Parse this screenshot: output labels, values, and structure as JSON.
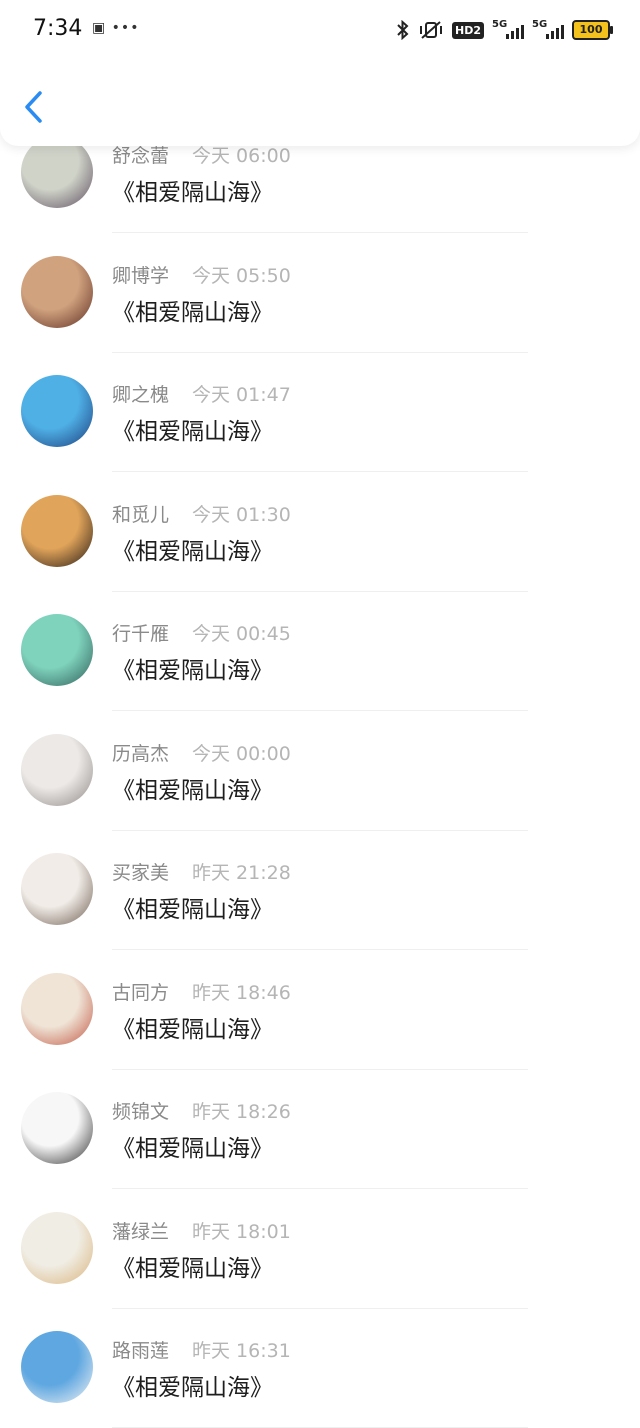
{
  "status_bar": {
    "time": "7:34",
    "misc": "▣ •••",
    "bluetooth_icon": "bluetooth-icon",
    "mute_icon": "vibrate-off-icon",
    "hd_badge": "HD2",
    "sim1": "5G",
    "sim2": "5G",
    "battery": "100",
    "battery_color": "#f3c21d"
  },
  "nav": {
    "back_icon": "chevron-left-icon",
    "accent": "#2a8cf2"
  },
  "items": [
    {
      "name": "舒念蕾",
      "time": "今天 06:00",
      "message": "《相爱隔山海》",
      "avatar_colors": [
        "#cfd3c8",
        "#5b4a5e"
      ]
    },
    {
      "name": "卿博学",
      "time": "今天 05:50",
      "message": "《相爱隔山海》",
      "avatar_colors": [
        "#d1a27e",
        "#5a2a20"
      ]
    },
    {
      "name": "卿之槐",
      "time": "今天 01:47",
      "message": "《相爱隔山海》",
      "avatar_colors": [
        "#4fb0e6",
        "#1b3a7a"
      ]
    },
    {
      "name": "和觅儿",
      "time": "今天 01:30",
      "message": "《相爱隔山海》",
      "avatar_colors": [
        "#e0a45a",
        "#201612"
      ]
    },
    {
      "name": "行千雁",
      "time": "今天 00:45",
      "message": "《相爱隔山海》",
      "avatar_colors": [
        "#7fd3bd",
        "#2d5a56"
      ]
    },
    {
      "name": "历高杰",
      "time": "今天 00:00",
      "message": "《相爱隔山海》",
      "avatar_colors": [
        "#ece9e6",
        "#8d8784"
      ]
    },
    {
      "name": "买家美",
      "time": "昨天 21:28",
      "message": "《相爱隔山海》",
      "avatar_colors": [
        "#f1ece7",
        "#6b5a4e"
      ]
    },
    {
      "name": "古同方",
      "time": "昨天 18:46",
      "message": "《相爱隔山海》",
      "avatar_colors": [
        "#efe4d6",
        "#c1533f"
      ]
    },
    {
      "name": "频锦文",
      "time": "昨天 18:26",
      "message": "《相爱隔山海》",
      "avatar_colors": [
        "#f7f7f7",
        "#2a2a2a"
      ]
    },
    {
      "name": "藩绿兰",
      "time": "昨天 18:01",
      "message": "《相爱隔山海》",
      "avatar_colors": [
        "#f0ede4",
        "#d9b27a"
      ]
    },
    {
      "name": "路雨莲",
      "time": "昨天 16:31",
      "message": "《相爱隔山海》",
      "avatar_colors": [
        "#5ea7e0",
        "#f4f4f4"
      ]
    }
  ]
}
